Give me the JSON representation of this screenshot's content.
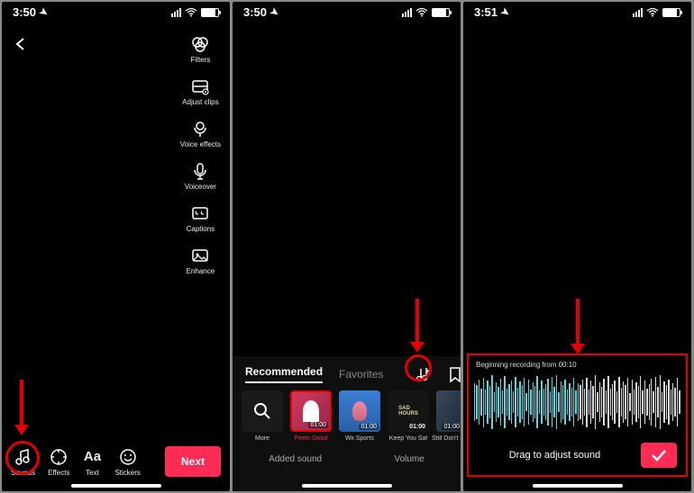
{
  "status": {
    "time1": "3:50",
    "time2": "3:50",
    "time3": "3:51"
  },
  "side_tools": {
    "filters": "Filters",
    "adjust_clips": "Adjust clips",
    "voice_effects": "Voice effects",
    "voiceover": "Voiceover",
    "captions": "Captions",
    "enhance": "Enhance"
  },
  "bottom_tools": {
    "sounds": "Sounds",
    "effects": "Effects",
    "text": "Text",
    "stickers": "Stickers"
  },
  "next_label": "Next",
  "sound_panel": {
    "tab_recommended": "Recommended",
    "tab_favorites": "Favorites",
    "more": "More",
    "tracks": [
      {
        "name": "Feels Good",
        "dur": "01:00"
      },
      {
        "name": "Wii Sports",
        "dur": "01:00"
      },
      {
        "name": "Keep You Saf",
        "dur": "01:00"
      },
      {
        "name": "Still Don't Kn",
        "dur": "01:00"
      }
    ],
    "added_sound": "Added sound",
    "volume": "Volume"
  },
  "trim": {
    "from": "Beginning recording from 00:10",
    "drag": "Drag to adjust sound"
  }
}
